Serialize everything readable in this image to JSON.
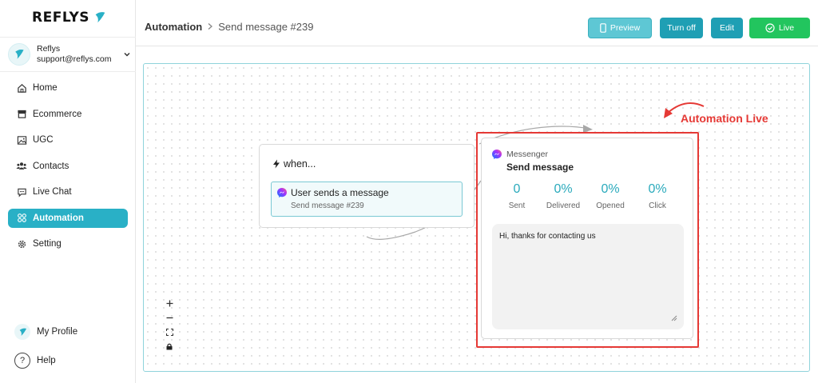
{
  "brand": {
    "name": "REFLYS",
    "accent": "#29b0c6"
  },
  "account": {
    "name": "Reflys",
    "email": "support@reflys.com"
  },
  "nav": {
    "items": [
      {
        "label": "Home",
        "icon": "home-icon"
      },
      {
        "label": "Ecommerce",
        "icon": "store-icon"
      },
      {
        "label": "UGC",
        "icon": "image-icon"
      },
      {
        "label": "Contacts",
        "icon": "users-icon"
      },
      {
        "label": "Live Chat",
        "icon": "chat-icon"
      },
      {
        "label": "Automation",
        "icon": "automation-icon",
        "active": true
      },
      {
        "label": "Setting",
        "icon": "gear-icon"
      }
    ],
    "profile": "My Profile",
    "help": "Help"
  },
  "header": {
    "breadcrumb_root": "Automation",
    "breadcrumb_current": "Send message #239",
    "buttons": {
      "preview": "Preview",
      "turn_off": "Turn off",
      "edit": "Edit",
      "live": "Live"
    }
  },
  "trigger": {
    "title": "when...",
    "event": "User sends a message",
    "sub": "Send message #239"
  },
  "message_node": {
    "source": "Messenger",
    "title": "Send message",
    "stats": [
      {
        "value": "0",
        "label": "Sent"
      },
      {
        "value": "0%",
        "label": "Delivered"
      },
      {
        "value": "0%",
        "label": "Opened"
      },
      {
        "value": "0%",
        "label": "Click"
      }
    ],
    "body": "Hi, thanks for contacting us"
  },
  "annotation": {
    "text": "Automation Live",
    "color": "#e53935"
  }
}
